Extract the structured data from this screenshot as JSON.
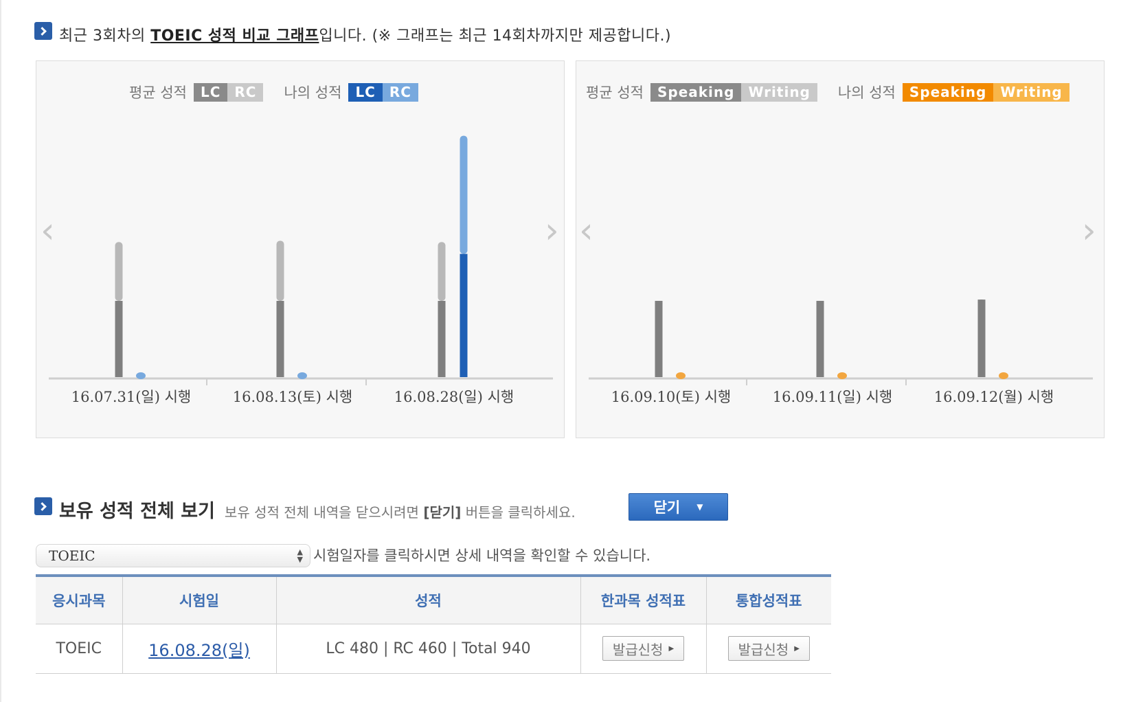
{
  "heading1": {
    "prefix": "최근 3회차의 ",
    "highlight": "TOEIC 성적 비교 그래프",
    "suffix": "입니다. (※ 그래프는 최근 14회차까지만 제공합니다.)"
  },
  "toeic_legend": {
    "avg_label": "평균 성적",
    "my_label": "나의 성적",
    "chip1": "LC",
    "chip2": "RC"
  },
  "sw_legend": {
    "avg_label": "평균 성적",
    "my_label": "나의 성적",
    "chip1": "Speaking",
    "chip2": "Writing"
  },
  "nav": {
    "prev": "‹",
    "next": "›"
  },
  "colors": {
    "avg_lc": "#7f7f7f",
    "avg_rc": "#b8b8b8",
    "my_lc": "#1e5fb5",
    "my_rc": "#78a9de",
    "my_sw": "#f2a640",
    "accent": "#2a5ea8"
  },
  "chart_data": [
    {
      "type": "bar",
      "categories": [
        "16.07.31(일) 시행",
        "16.08.13(토) 시행",
        "16.08.28(일) 시행"
      ],
      "series": [
        {
          "name": "평균 LC",
          "values": [
            297,
            297,
            297
          ]
        },
        {
          "name": "평균 RC",
          "values": [
            229,
            234,
            229
          ]
        },
        {
          "name": "나의 LC",
          "values": [
            0,
            0,
            480
          ]
        },
        {
          "name": "나의 RC",
          "values": [
            0,
            0,
            460
          ]
        }
      ],
      "ylim": [
        0,
        990
      ]
    },
    {
      "type": "bar",
      "categories": [
        "16.09.10(토) 시행",
        "16.09.11(일) 시행",
        "16.09.12(월) 시행"
      ],
      "series": [
        {
          "name": "평균 Speaking",
          "values": [
            120,
            120,
            122
          ]
        },
        {
          "name": "평균 Writing",
          "values": [
            0,
            0,
            0
          ]
        },
        {
          "name": "나의 Speaking",
          "values": [
            0,
            0,
            0
          ]
        },
        {
          "name": "나의 Writing",
          "values": [
            0,
            0,
            0
          ]
        }
      ],
      "ylim": [
        0,
        400
      ]
    }
  ],
  "heading2": {
    "title": "보유 성적 전체 보기",
    "desc_prefix": "보유 성적 전체 내역을 닫으시려면 ",
    "desc_bold": "[닫기]",
    "desc_suffix": " 버튼을 클릭하세요."
  },
  "close_button": "닫기",
  "select": {
    "value": "TOEIC"
  },
  "hint": "시험일자를 클릭하시면 상세 내역을 확인할 수 있습니다.",
  "table": {
    "headers": [
      "응시과목",
      "시험일",
      "성적",
      "한과목 성적표",
      "통합성적표"
    ],
    "rows": [
      {
        "subject": "TOEIC",
        "date": "16.08.28(일)",
        "score": "LC 480 | RC 460 | Total 940",
        "btn1": "발급신청",
        "btn2": "발급신청"
      }
    ]
  }
}
